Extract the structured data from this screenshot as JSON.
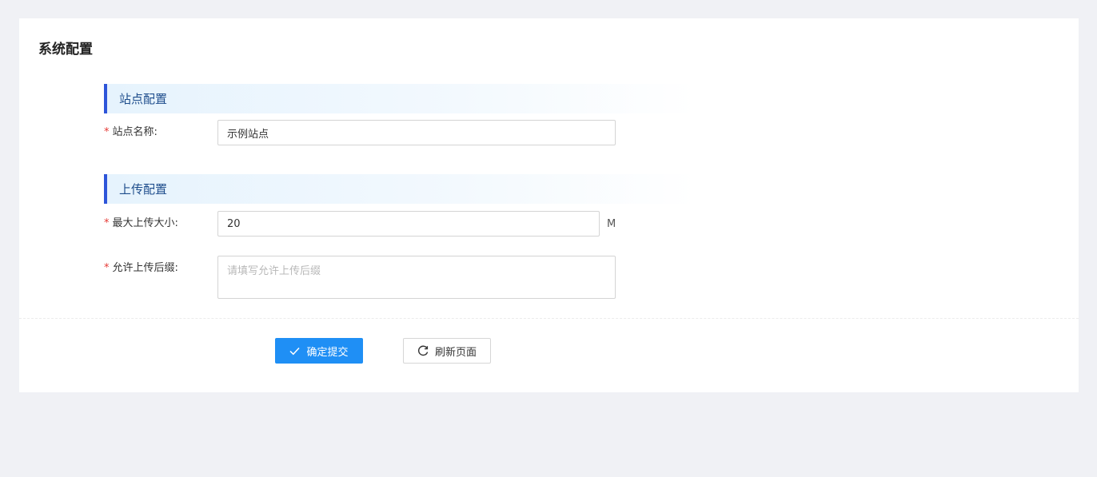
{
  "page": {
    "title": "系统配置"
  },
  "site_section": {
    "title": "站点配置",
    "site_name": {
      "label": "站点名称:",
      "value": "示例站点"
    }
  },
  "upload_section": {
    "title": "上传配置",
    "max_size": {
      "label": "最大上传大小:",
      "value": "20",
      "unit": "M"
    },
    "allowed_ext": {
      "label": "允许上传后缀:",
      "value": "",
      "placeholder": "请填写允许上传后缀"
    }
  },
  "actions": {
    "submit_label": "确定提交",
    "submit_icon": "check-icon",
    "refresh_label": "刷新页面",
    "refresh_icon": "refresh-icon"
  },
  "colors": {
    "page_bg": "#f0f1f5",
    "accent": "#2d55d9",
    "primary_button": "#1f8ff5",
    "required_mark": "#e53935"
  }
}
